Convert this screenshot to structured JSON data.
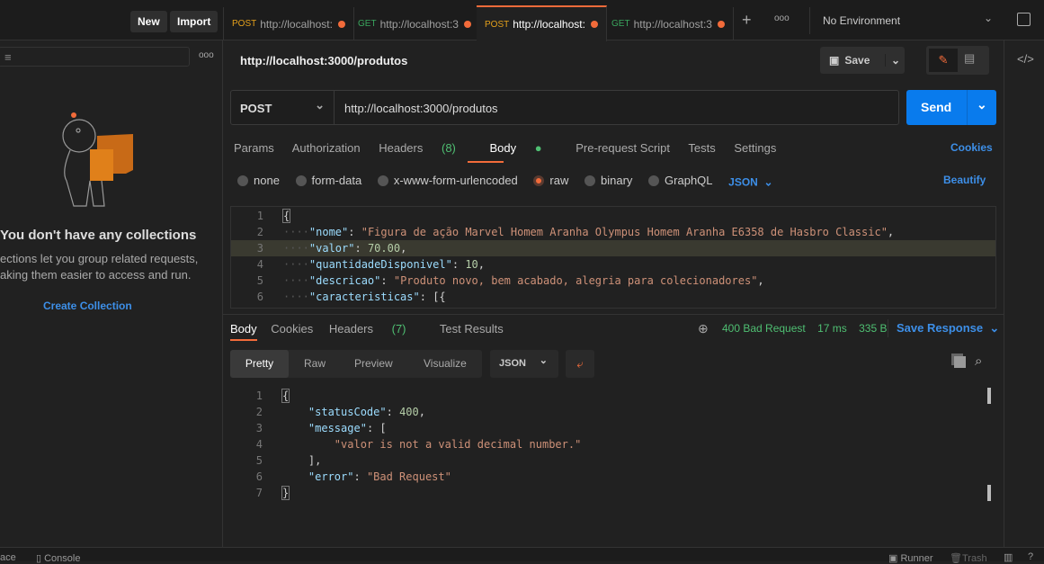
{
  "header": {
    "new_label": "New",
    "import_label": "Import",
    "tabs": [
      {
        "method": "POST",
        "label": "http://localhost:",
        "unsaved": true
      },
      {
        "method": "GET",
        "label": "http://localhost:3",
        "unsaved": true
      },
      {
        "method": "POST",
        "label": "http://localhost:",
        "unsaved": true,
        "active": true
      },
      {
        "method": "GET",
        "label": "http://localhost:3",
        "unsaved": true
      }
    ],
    "add_tab": "+",
    "more": "ooo",
    "environment": "No Environment"
  },
  "sidebar": {
    "more": "ooo",
    "empty_title": "You don't have any collections",
    "empty_text_1": "ections let you group related requests,",
    "empty_text_2": "aking them easier to access and run.",
    "create_label": "Create Collection"
  },
  "request": {
    "title": "http://localhost:3000/produtos",
    "save_label": "Save",
    "method": "POST",
    "url": "http://localhost:3000/produtos",
    "send_label": "Send",
    "tabs": [
      "Params",
      "Authorization",
      "Headers",
      "Body",
      "Pre-request Script",
      "Tests",
      "Settings"
    ],
    "headers_count": "(8)",
    "cookies_label": "Cookies",
    "body_types": [
      "none",
      "form-data",
      "x-www-form-urlencoded",
      "raw",
      "binary",
      "GraphQL"
    ],
    "selected_body_type": "raw",
    "format": "JSON",
    "beautify_label": "Beautify"
  },
  "request_body": [
    {
      "n": "1",
      "code": "{"
    },
    {
      "n": "2",
      "key": "nome",
      "val": "\"Figura de ação Marvel Homem Aranha Olympus Homem Aranha E6358 de Hasbro Classic\"",
      "type": "s",
      "tail": ","
    },
    {
      "n": "3",
      "key": "valor",
      "val": "70.00",
      "type": "n",
      "tail": ","
    },
    {
      "n": "4",
      "key": "quantidadeDisponivel",
      "val": "10",
      "type": "n",
      "tail": ","
    },
    {
      "n": "5",
      "key": "descricao",
      "val": "\"Produto novo, bem acabado, alegria para colecionadores\"",
      "type": "s",
      "tail": ","
    },
    {
      "n": "6",
      "key": "caracteristicas",
      "val": "[{",
      "type": "p",
      "tail": ""
    }
  ],
  "response": {
    "tabs": [
      "Body",
      "Cookies",
      "Headers",
      "Test Results"
    ],
    "headers_count": "(7)",
    "status": "400 Bad Request",
    "time": "17 ms",
    "size": "335 B",
    "save_label": "Save Response",
    "views": [
      "Pretty",
      "Raw",
      "Preview",
      "Visualize"
    ],
    "format": "JSON"
  },
  "response_body": [
    {
      "n": "1",
      "html": "{"
    },
    {
      "n": "2",
      "key": "statusCode",
      "val": "400",
      "type": "n",
      "tail": ","
    },
    {
      "n": "3",
      "key": "message",
      "val": "[",
      "type": "p",
      "tail": ""
    },
    {
      "n": "4",
      "str": "\"valor is not a valid decimal number.\""
    },
    {
      "n": "5",
      "plain": "],"
    },
    {
      "n": "6",
      "key": "error",
      "val": "\"Bad Request\"",
      "type": "s",
      "tail": ""
    },
    {
      "n": "7",
      "html": "}"
    }
  ],
  "footer": {
    "left_label": "ace",
    "console_label": "Console",
    "runner_label": "Runner",
    "trash_label": "Trash"
  },
  "colors": {
    "accent": "#f26b3a",
    "link": "#3d8fe8",
    "send": "#097bed",
    "status": "#4fbf72"
  }
}
